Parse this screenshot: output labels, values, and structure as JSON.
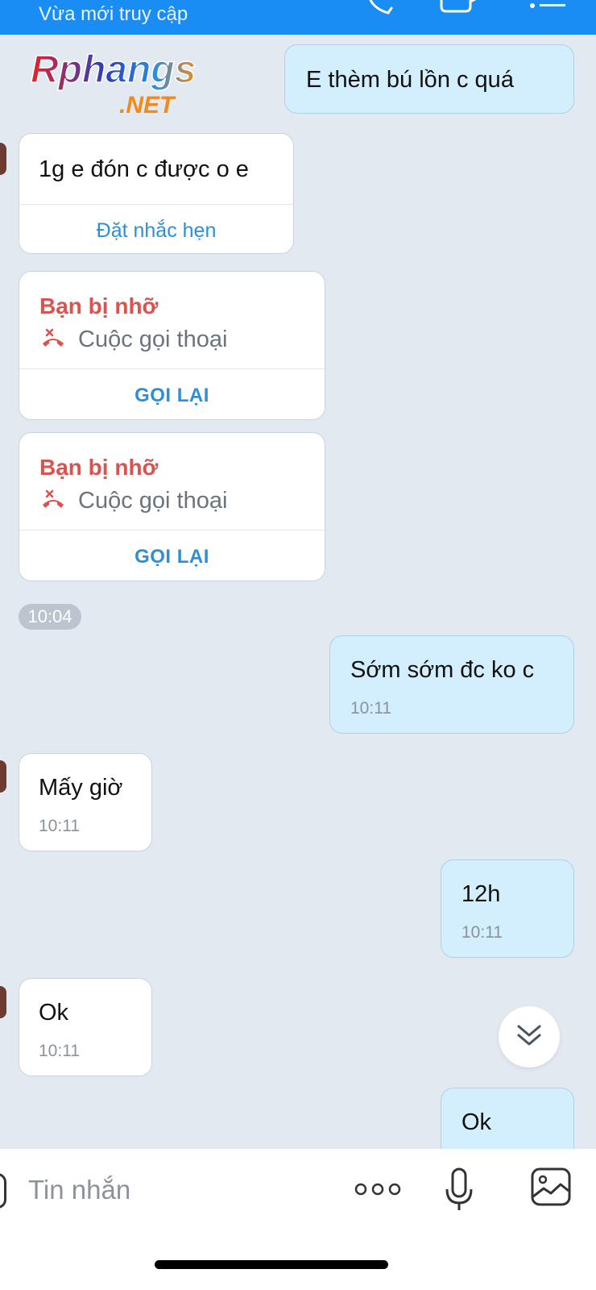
{
  "header": {
    "status": "Vừa mới truy cập",
    "icons": [
      "phone-icon",
      "video-call-icon",
      "menu-icon"
    ]
  },
  "watermark": {
    "brand": "Rphangs",
    "tld": ".NET"
  },
  "messages": {
    "out1": {
      "text": "E thèm bú lồn c quá"
    },
    "in1": {
      "text": "1g e đón c được o e",
      "action": "Đặt nhắc hẹn"
    },
    "missed1": {
      "title": "Bạn bị nhỡ",
      "call_label": "Cuộc gọi thoại",
      "action": "GỌI LẠI"
    },
    "missed2": {
      "title": "Bạn bị nhỡ",
      "call_label": "Cuộc gọi thoại",
      "action": "GỌI LẠI"
    },
    "time_pill": "10:04",
    "out2": {
      "text": "Sớm sớm đc ko c",
      "time": "10:11"
    },
    "in2": {
      "text": "Mấy giờ",
      "time": "10:11"
    },
    "out3": {
      "text": "12h",
      "time": "10:11"
    },
    "in3": {
      "text": "Ok",
      "time": "10:11"
    },
    "out4": {
      "text": "Ok"
    }
  },
  "input": {
    "placeholder": "Tin nhắn",
    "icons": [
      "more-options-icon",
      "microphone-icon",
      "image-icon"
    ]
  },
  "colors": {
    "header": "#1a8df5",
    "background": "#e2e9f1",
    "outgoing_bubble": "#d3eefc",
    "missed_call": "#d9534f",
    "link": "#2d8fd5"
  }
}
